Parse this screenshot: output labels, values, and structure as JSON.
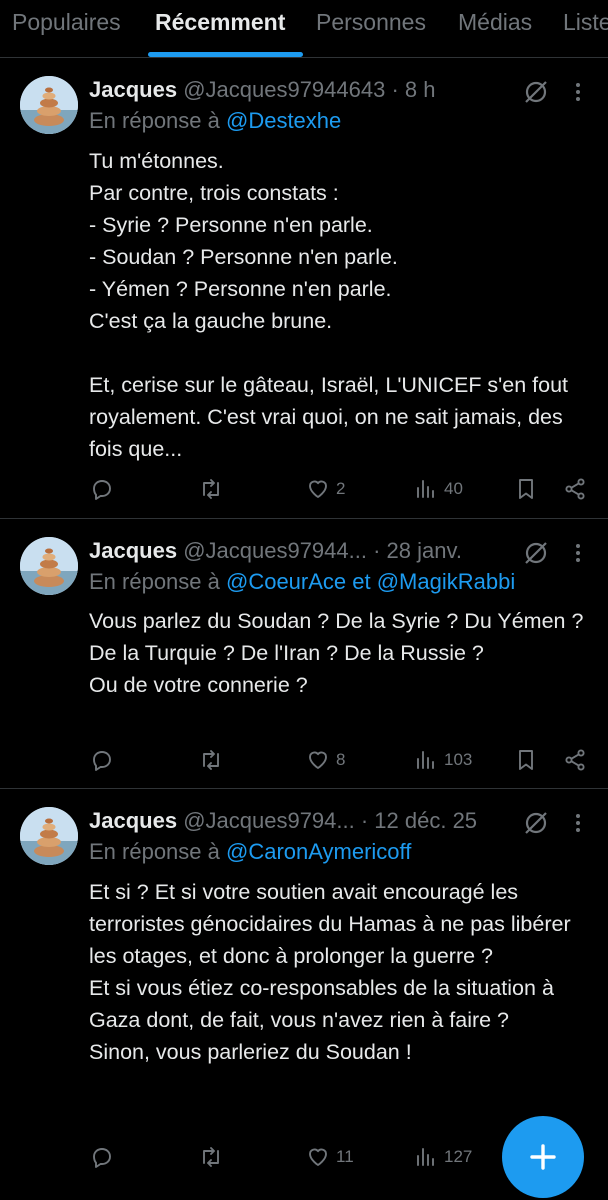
{
  "tabs": [
    {
      "label": "Populaires"
    },
    {
      "label": "Récemment",
      "active": true
    },
    {
      "label": "Personnes"
    },
    {
      "label": "Médias"
    },
    {
      "label": "Listes"
    }
  ],
  "tweets": [
    {
      "name": "Jacques",
      "handle_time": "@Jacques97944643 · 8 h",
      "reply_prefix": "En réponse à ",
      "reply_to": "@Destexhe",
      "text": "Tu m'étonnes.\nPar contre, trois constats :\n- Syrie ? Personne n'en parle.\n- Soudan ? Personne n'en parle.\n- Yémen ? Personne n'en parle.\nC'est ça la gauche brune.\n\nEt, cerise sur le gâteau, Israël, L'UNICEF s'en fout royalement. C'est vrai quoi, on ne sait jamais, des fois que...",
      "likes": "2",
      "views": "40"
    },
    {
      "name": "Jacques",
      "handle_time": "@Jacques97944... · 28 janv.",
      "reply_prefix": "En réponse à ",
      "reply_to": "@CoeurAce et @MagikRabbi",
      "text": "Vous parlez du Soudan ? De la Syrie ? Du Yémen ?  De la Turquie ? De l'Iran ? De la Russie ?\nOu de votre connerie ?",
      "likes": "8",
      "views": "103"
    },
    {
      "name": "Jacques",
      "handle_time": "@Jacques9794... · 12 déc. 25",
      "reply_prefix": "En réponse à ",
      "reply_to": "@CaronAymericoff",
      "text": "Et si ? Et si votre soutien avait encouragé les terroristes génocidaires du Hamas à ne pas libérer les otages, et donc à prolonger la guerre ?\nEt si vous étiez co-responsables de la situation à Gaza dont, de fait, vous n'avez rien à faire ?\nSinon, vous parleriez du Soudan !",
      "likes": "11",
      "views": "127"
    }
  ],
  "icons": {
    "reply": "reply-icon",
    "retweet": "retweet-icon",
    "like": "heart-icon",
    "views": "views-icon",
    "bookmark": "bookmark-icon",
    "share": "share-icon",
    "grok": "grok-icon",
    "more": "more-icon",
    "compose": "compose-plus-icon"
  },
  "colors": {
    "accent": "#1d9bf0",
    "background": "#000000",
    "muted": "#71767b",
    "text": "#e7e9ea"
  }
}
